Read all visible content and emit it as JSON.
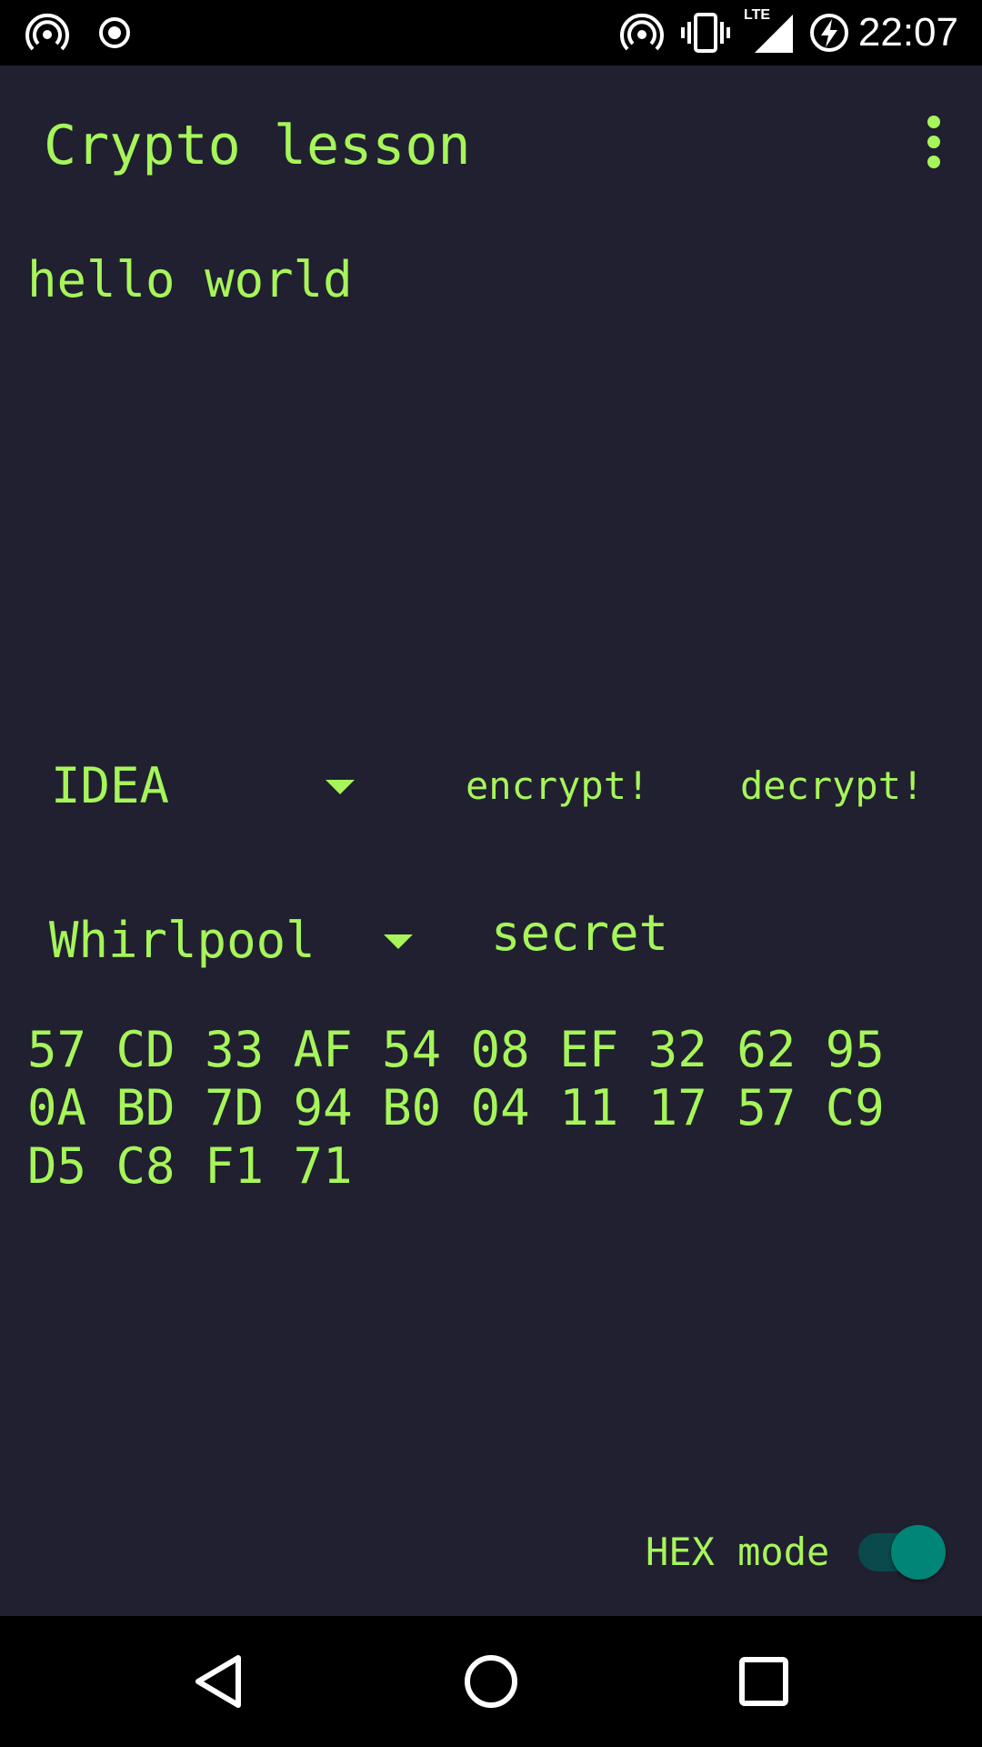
{
  "status_bar": {
    "time": "22:07",
    "icons": [
      "hotspot-icon",
      "record-icon",
      "hotspot-icon",
      "vibrate-icon",
      "lte-signal-icon",
      "battery-charging-icon"
    ],
    "network_label": "LTE"
  },
  "app_bar": {
    "title": "Crypto lesson",
    "menu_icon": "more-vert-icon"
  },
  "input": {
    "text": "hello world"
  },
  "cipher": {
    "selected": "IDEA",
    "encrypt_label": "encrypt!",
    "decrypt_label": "decrypt!"
  },
  "hash": {
    "selected": "Whirlpool",
    "key": "secret",
    "output": "57 CD 33 AF 54 08 EF 32 62 95\n0A BD 7D 94 B0 04 11 17 57 C9\nD5 C8 F1 71"
  },
  "hex_mode": {
    "label": "HEX mode",
    "enabled": true
  },
  "nav_bar": {
    "icons": [
      "back-icon",
      "home-icon",
      "recents-icon"
    ]
  },
  "colors": {
    "background": "#212030",
    "accent_text": "#a6f55a",
    "toggle_thumb": "#008577",
    "system_bars": "#000000"
  }
}
